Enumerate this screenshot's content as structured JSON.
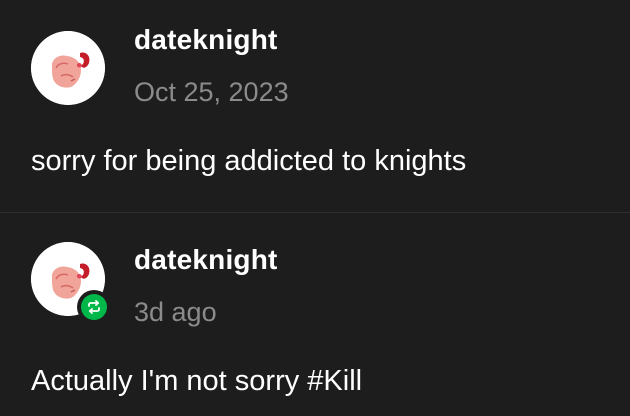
{
  "posts": [
    {
      "username": "dateknight",
      "timestamp": "Oct 25, 2023",
      "body": "sorry for being addicted to knights",
      "avatar_icon": "pink-creature-avatar",
      "reblogged": false
    },
    {
      "username": "dateknight",
      "timestamp": "3d ago",
      "body": "Actually I'm not sorry #Kill",
      "avatar_icon": "pink-creature-avatar",
      "reblogged": true,
      "badge_icon": "reblog-icon"
    }
  ],
  "colors": {
    "background": "#1d1d1d",
    "username": "#ffffff",
    "timestamp": "#8b8b8b",
    "reblog_badge": "#00b84a",
    "avatar_bg": "#ffffff"
  }
}
